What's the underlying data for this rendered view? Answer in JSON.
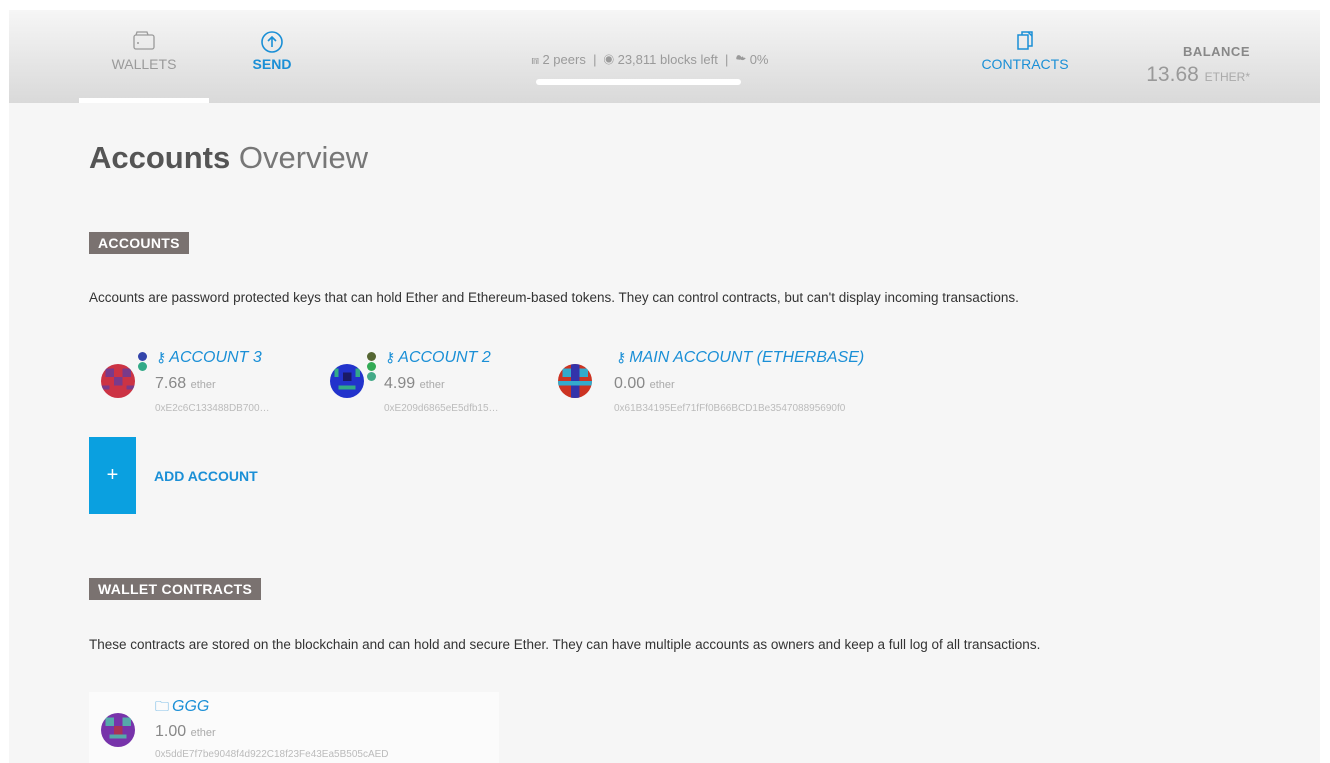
{
  "nav": {
    "wallets_label": "WALLETS",
    "send_label": "SEND",
    "contracts_label": "CONTRACTS"
  },
  "sync": {
    "peers": "2 peers",
    "blocks_left": "23,811 blocks left",
    "progress": "0%",
    "progress_value": 0.0
  },
  "balance": {
    "label": "BALANCE",
    "amount": "13.68",
    "unit": "ETHER*"
  },
  "page": {
    "title_bold": "Accounts",
    "title_light": "Overview"
  },
  "accounts_section": {
    "label": "ACCOUNTS",
    "description": "Accounts are password protected keys that can hold Ether and Ethereum-based tokens. They can control contracts, but can't display incoming transactions.",
    "items": [
      {
        "name": "ACCOUNT 3",
        "balance": "7.68",
        "unit": "ether",
        "address": "0xE2c6C133488DB700…"
      },
      {
        "name": "ACCOUNT 2",
        "balance": "4.99",
        "unit": "ether",
        "address": "0xE209d6865eE5dfb15…"
      },
      {
        "name": "MAIN ACCOUNT (ETHERBASE)",
        "balance": "0.00",
        "unit": "ether",
        "address": "0x61B34195Eef71fFf0B66BCD1Be354708895690f0"
      }
    ],
    "add_button_symbol": "+",
    "add_label": "ADD ACCOUNT"
  },
  "wallets_section": {
    "label": "WALLET CONTRACTS",
    "description": "These contracts are stored on the blockchain and can hold and secure Ether. They can have multiple accounts as owners and keep a full log of all transactions.",
    "items": [
      {
        "name": "GGG",
        "balance": "1.00",
        "unit": "ether",
        "address": "0x5ddE7f7be9048f4d922C18f23Fe43Ea5B505cAED"
      }
    ]
  },
  "icons": {
    "wallets": "wallet-icon",
    "send": "send-arrow-icon",
    "contracts": "contracts-icon",
    "peers": "peers-signal-icon",
    "blocks": "blocks-icon",
    "download": "download-cloud-icon",
    "key": "key-icon",
    "wallet_folder": "folder-icon"
  },
  "colors": {
    "accent": "#1a8fd6",
    "add_button": "#0aa0e0",
    "section_label_bg": "#7a7270"
  }
}
